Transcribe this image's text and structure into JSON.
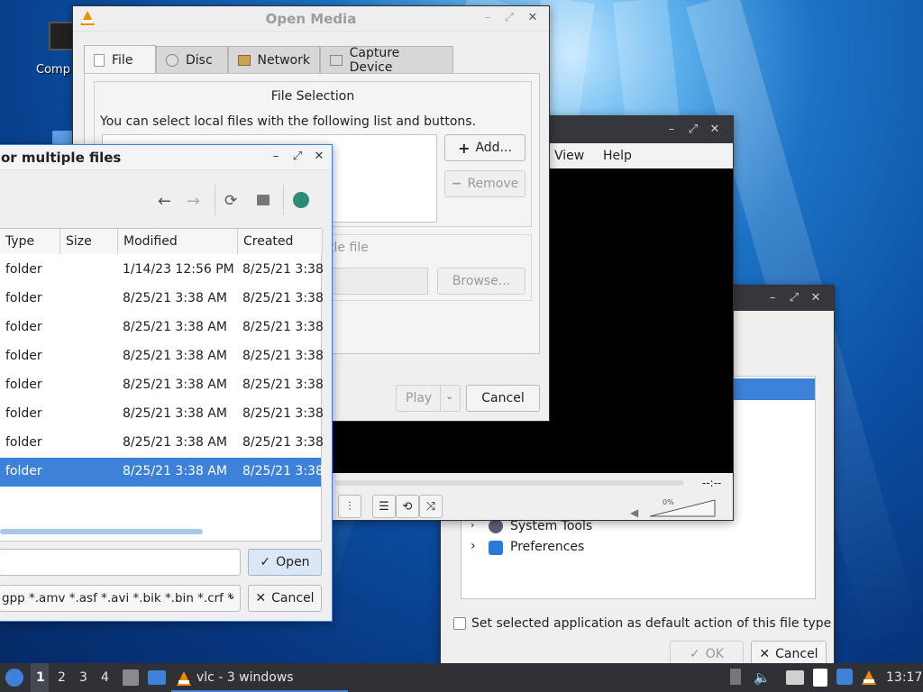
{
  "desktop": {
    "icon_label": "Comp"
  },
  "open_media": {
    "title": "Open Media",
    "tabs": [
      {
        "label": "File",
        "icon": "file-icon"
      },
      {
        "label": "Disc",
        "icon": "disc-icon"
      },
      {
        "label": "Network",
        "icon": "network-icon"
      },
      {
        "label": "Capture Device",
        "icon": "capture-icon"
      }
    ],
    "file_selection_title": "File Selection",
    "file_selection_desc": "You can select local files with the following list and buttons.",
    "add_button": "Add...",
    "remove_button": "Remove",
    "subtitle_label": "tle file",
    "browse_button": "Browse...",
    "play_button": "Play",
    "cancel_button": "Cancel"
  },
  "vlc_main": {
    "menu": [
      "View",
      "Help"
    ],
    "time": "--:--",
    "volume": "0%"
  },
  "app_chooser": {
    "tree_items": [
      {
        "label": "System Tools"
      },
      {
        "label": "Preferences"
      }
    ],
    "default_checkbox": "Set selected application as default action of this file type",
    "ok_button": "OK",
    "cancel_button": "Cancel"
  },
  "file_dialog": {
    "title": "or multiple files",
    "columns": [
      "Type",
      "Size",
      "Modified",
      "Created"
    ],
    "rows": [
      {
        "type": "folder",
        "modified": "1/14/23 12:56 PM",
        "created": "8/25/21 3:38"
      },
      {
        "type": "folder",
        "modified": "8/25/21 3:38 AM",
        "created": "8/25/21 3:38"
      },
      {
        "type": "folder",
        "modified": "8/25/21 3:38 AM",
        "created": "8/25/21 3:38"
      },
      {
        "type": "folder",
        "modified": "8/25/21 3:38 AM",
        "created": "8/25/21 3:38"
      },
      {
        "type": "folder",
        "modified": "8/25/21 3:38 AM",
        "created": "8/25/21 3:38"
      },
      {
        "type": "folder",
        "modified": "8/25/21 3:38 AM",
        "created": "8/25/21 3:38"
      },
      {
        "type": "folder",
        "modified": "8/25/21 3:38 AM",
        "created": "8/25/21 3:38"
      },
      {
        "type": "folder",
        "modified": "8/25/21 3:38 AM",
        "created": "8/25/21 3:38"
      }
    ],
    "filename_value": "",
    "filter_value": "gpp *.amv *.asf *.avi *.bik *.bin *.crf *",
    "open_button": "Open",
    "cancel_button": "Cancel"
  },
  "taskbar": {
    "workspaces": [
      "1",
      "2",
      "3",
      "4"
    ],
    "task_label": "vlc - 3 windows",
    "clock": "13:17"
  },
  "colors": {
    "titlebar": "#35373c",
    "selection": "#3d81d8",
    "window_bg": "#efefef",
    "vlc_orange": "#f08a00"
  }
}
